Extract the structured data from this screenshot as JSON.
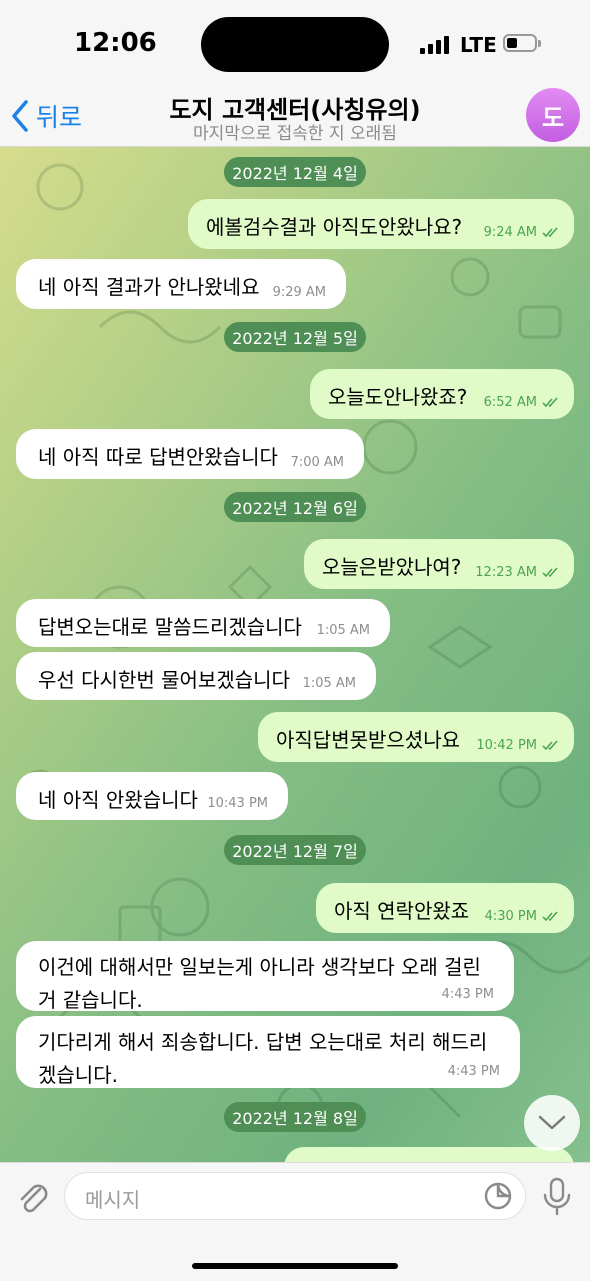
{
  "status_bar": {
    "time": "12:06",
    "network": "LTE"
  },
  "header": {
    "back_label": "뒤로",
    "title": "도지 고객센터(사칭유의)",
    "subtitle": "마지막으로 접속한 지 오래됨",
    "avatar_letter": "도"
  },
  "dates": [
    "2022년 12월 4일",
    "2022년 12월 5일",
    "2022년 12월 6일",
    "2022년 12월 7일",
    "2022년 12월 8일"
  ],
  "messages": [
    {
      "text": "에볼검수결과 아직도안왔나요?",
      "time": "9:24 AM"
    },
    {
      "text": "네 아직 결과가 안나왔네요",
      "time": "9:29 AM"
    },
    {
      "text": "오늘도안나왔죠?",
      "time": "6:52 AM"
    },
    {
      "text": "네 아직 따로 답변안왔습니다",
      "time": "7:00 AM"
    },
    {
      "text": "오늘은받았나여?",
      "time": "12:23 AM"
    },
    {
      "text": "답변오는대로 말씀드리겠습니다",
      "time": "1:05 AM"
    },
    {
      "text": "우선 다시한번 물어보겠습니다",
      "time": "1:05 AM"
    },
    {
      "text": "아직답변못받으셨나요",
      "time": "10:42 PM"
    },
    {
      "text": "네 아직 안왔습니다",
      "time": "10:43 PM"
    },
    {
      "text": "아직 연락안왔죠",
      "time": "4:30 PM"
    },
    {
      "line1": "이건에 대해서만 일보는게 아니라 생각보다 오래 걸린",
      "line2": "거 같습니다.",
      "time": "4:43 PM"
    },
    {
      "line1": "기다리게 해서 죄송합니다. 답변 오는대로 처리 해드리",
      "line2": "겠습니다.",
      "time": "4:43 PM"
    }
  ],
  "input": {
    "placeholder": "메시지"
  },
  "colors": {
    "accent": "#1a82e6",
    "outgoing_bubble": "#e1fbc8",
    "incoming_bubble": "#ffffff",
    "date_pill": "#4f8f55",
    "outgoing_time": "#4ca54f"
  }
}
